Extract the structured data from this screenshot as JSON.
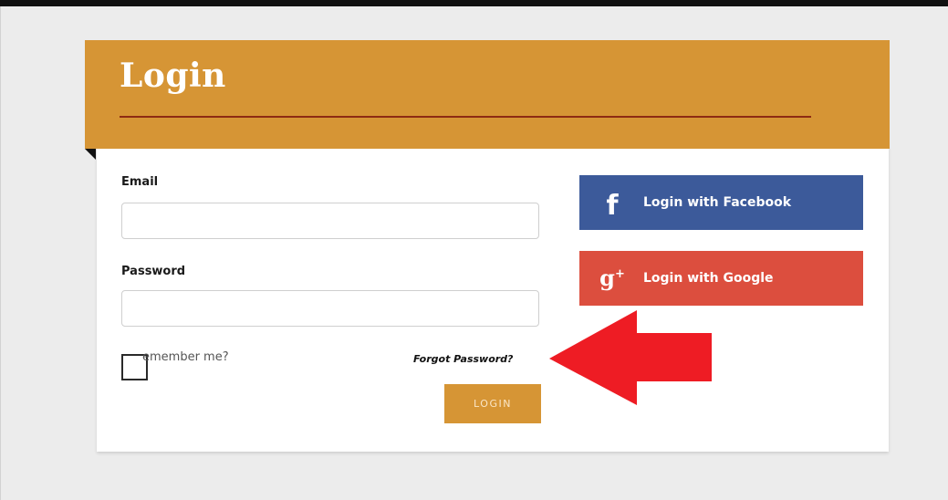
{
  "form": {
    "title": "Login",
    "email_label": "Email",
    "email_value": "",
    "password_label": "Password",
    "password_value": "",
    "remember_label": "emember me?",
    "remember_checked": false,
    "forgot_label": "Forgot Password?",
    "login_label": "LOGIN"
  },
  "social": {
    "facebook_label": "Login with Facebook",
    "facebook_icon": "facebook-f-icon",
    "google_label": "Login with Google",
    "google_icon": "google-plus-icon"
  },
  "annotation": {
    "arrow_icon": "red-arrow-pointing-left",
    "arrow_color": "#ee1c24"
  },
  "colors": {
    "brand": "#d69535",
    "accent_rule": "#8e2a12",
    "facebook": "#3c5a9a",
    "google": "#dc4e3e"
  }
}
